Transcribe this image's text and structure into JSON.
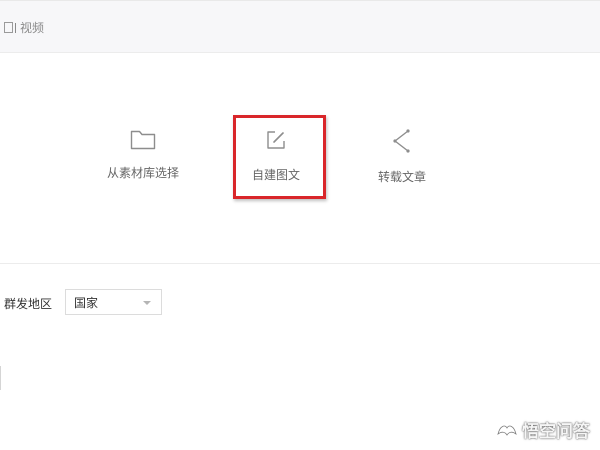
{
  "tabs": {
    "video_label": "视频"
  },
  "options": {
    "library": {
      "label": "从素材库选择",
      "icon": "folder-icon"
    },
    "create": {
      "label": "自建图文",
      "icon": "edit-icon"
    },
    "repost": {
      "label": "转载文章",
      "icon": "share-icon"
    }
  },
  "highlight": {
    "color": "#d9262a"
  },
  "region": {
    "label": "群发地区",
    "selected": "国家"
  },
  "watermark": {
    "text": "悟空问答",
    "icon": "wukong-logo-icon"
  }
}
